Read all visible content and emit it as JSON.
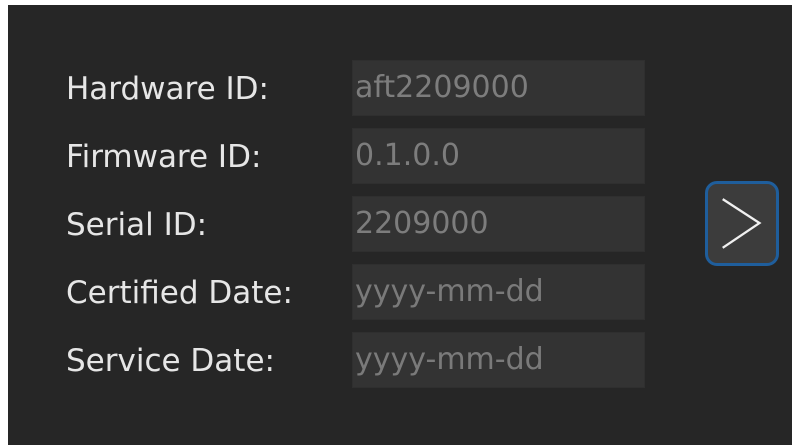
{
  "form": {
    "fields": [
      {
        "label": "Hardware ID:",
        "value": "aft2209000",
        "placeholder": ""
      },
      {
        "label": "Firmware ID:",
        "value": "0.1.0.0",
        "placeholder": ""
      },
      {
        "label": "Serial ID:",
        "value": "2209000",
        "placeholder": ""
      },
      {
        "label": "Certified Date:",
        "value": "",
        "placeholder": "yyyy-mm-dd"
      },
      {
        "label": "Service Date:",
        "value": "",
        "placeholder": "yyyy-mm-dd"
      }
    ]
  },
  "navigation": {
    "next_icon": "chevron-right-icon",
    "accent_color": "#1f5e9c"
  },
  "colors": {
    "background": "#262626",
    "field_background": "#333333",
    "label_text": "#e6e6e6",
    "field_text": "#7d7d7d"
  }
}
